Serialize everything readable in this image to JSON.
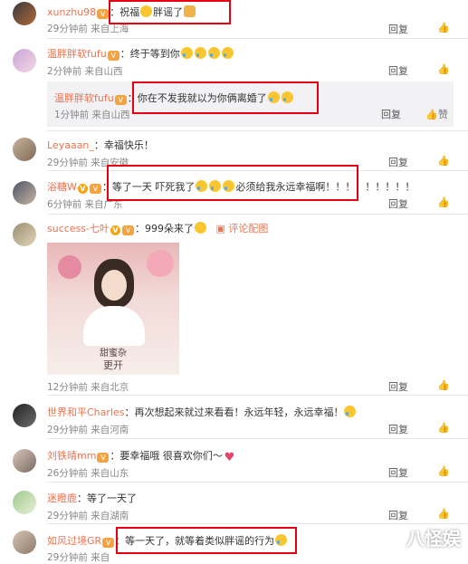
{
  "ui": {
    "reply": "回复",
    "like_icon": "thumb-up-icon",
    "like_label": "赞",
    "comment_image": "评论配图",
    "watermark": "八怪娱"
  },
  "comments": [
    {
      "user": "xunzhu98",
      "text": "：祝福",
      "text2": "胖谣了",
      "time": "29分钟前 来自上海"
    },
    {
      "user": "温胖胖软fufu",
      "text": "：终于等到你",
      "time": "2分钟前 来自山西"
    },
    {
      "user": "温胖胖软fufu",
      "text": "：你在不发我就以为你俩离婚了",
      "time": "1分钟前 来自山西"
    },
    {
      "user": "Leyaaan_",
      "text": "：幸福快乐！",
      "time": "29分钟前 来自安徽"
    },
    {
      "user": "浴糖W",
      "text": "：等了一天 吓死我了",
      "text2": "必须给我永远幸福啊！！！！！！！！！",
      "time": "6分钟前 来自广东"
    },
    {
      "user": "success-七叶",
      "text": "：999朵来了",
      "time": "12分钟前 来自北京",
      "caption": "甜蜜杂",
      "caption2": "更开"
    },
    {
      "user": "世界和平Charles",
      "text": "：再次想起来就过来看看！永远年轻，永远幸福！",
      "time": "29分钟前 来自河南"
    },
    {
      "user": "刘铁晴mm",
      "text": "：要幸福哦 很喜欢你们～",
      "time": "26分钟前 来自山东"
    },
    {
      "user": "迷瞪鹿",
      "text": "：等了一天了",
      "time": "29分钟前 来自湖南"
    },
    {
      "user": "如风过境GR",
      "text": "：等一天了，就等着类似胖谣的行为",
      "time": "29分钟前 来自"
    }
  ]
}
